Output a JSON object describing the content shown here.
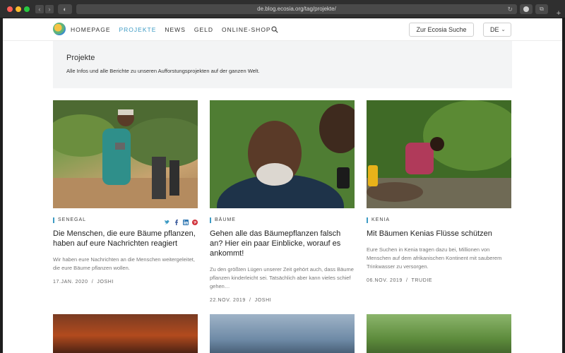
{
  "browser": {
    "url": "de.blog.ecosia.org/tag/projekte/"
  },
  "header": {
    "nav": [
      "HOMEPAGE",
      "PROJEKTE",
      "NEWS",
      "GELD",
      "ONLINE-SHOP"
    ],
    "active_nav": "PROJEKTE",
    "cta_label": "Zur Ecosia Suche",
    "language": "DE"
  },
  "banner": {
    "title": "Projekte",
    "subtitle": "Alle Infos und alle Berichte zu unseren Aufforstungsprojekten auf der ganzen Welt."
  },
  "posts": [
    {
      "category": "SENEGAL",
      "title": "Die Menschen, die eure Bäume pflanzen, haben auf eure Nachrichten reagiert",
      "excerpt": "Wir haben eure Nachrichten an die Menschen weitergeleitet, die eure Bäume pflanzen wollen.",
      "date": "17.JAN. 2020",
      "author": "JOSHI"
    },
    {
      "category": "BÄUME",
      "title": "Gehen alle das Bäumepflanzen falsch an? Hier ein paar Einblicke, worauf es ankommt!",
      "excerpt": "Zu den größten Lügen unserer Zeit gehört auch, dass Bäume pflanzen kinderleicht sei. Tatsächlich aber kann vieles schief gehen…",
      "date": "22.NOV. 2019",
      "author": "JOSHI"
    },
    {
      "category": "KENIA",
      "title": "Mit Bäumen Kenias Flüsse schützen",
      "excerpt": "Eure Suchen in Kenia tragen dazu bei, Millionen von Menschen auf dem afrikanischen Kontinent mit sauberem Trinkwasser zu versorgen.",
      "date": "06.NOV. 2019",
      "author": "TRUDIE"
    }
  ],
  "colors": {
    "accent": "#3d9bc4",
    "banner_bg": "#f3f4f5"
  },
  "icons": {
    "twitter": "twitter-icon",
    "facebook": "facebook-icon",
    "linkedin": "linkedin-icon",
    "pinterest": "pinterest-icon"
  }
}
